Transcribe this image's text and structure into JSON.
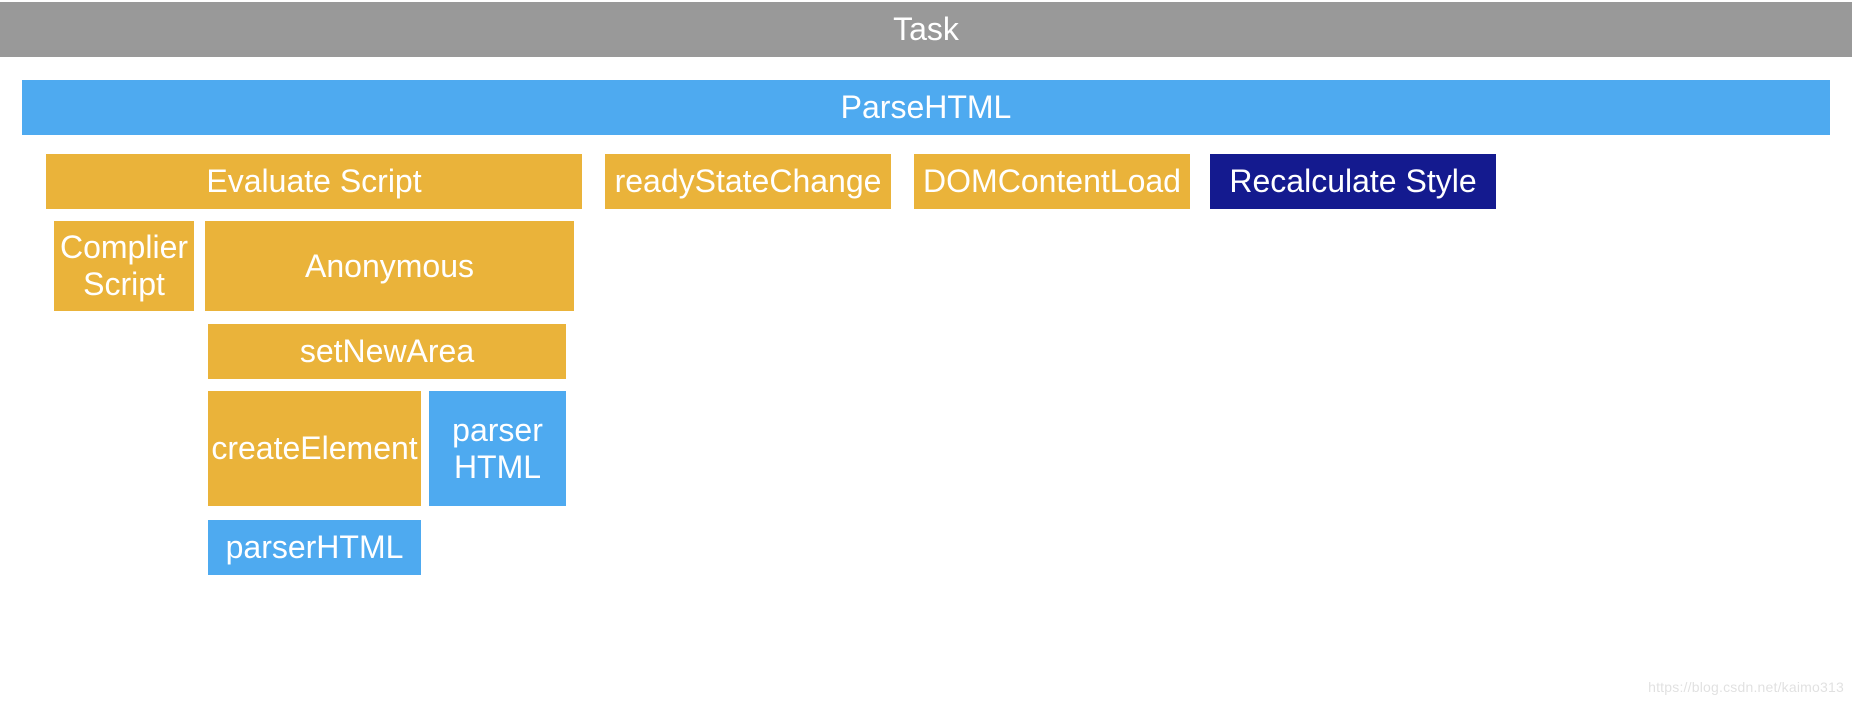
{
  "colors": {
    "gray": "#999999",
    "blue": "#4eaaf0",
    "yellow": "#eab33a",
    "navy": "#141a8f"
  },
  "rows": {
    "task": {
      "label": "Task"
    },
    "parseHtml": {
      "label": "ParseHTML"
    },
    "row3": {
      "evaluateScript": "Evaluate Script",
      "readyStateChange": "readyStateChange",
      "domContentLoad": "DOMContentLoad",
      "recalculateStyle": "Recalculate Style"
    },
    "row4": {
      "compilerScript": "Complier Script",
      "anonymous": "Anonymous"
    },
    "row5": {
      "setNewArea": "setNewArea"
    },
    "row6": {
      "createElement": "createElement",
      "parserHtmlSmall": "parser HTML"
    },
    "row7": {
      "parserHtml": "parserHTML"
    }
  },
  "watermark": "https://blog.csdn.net/kaimo313"
}
